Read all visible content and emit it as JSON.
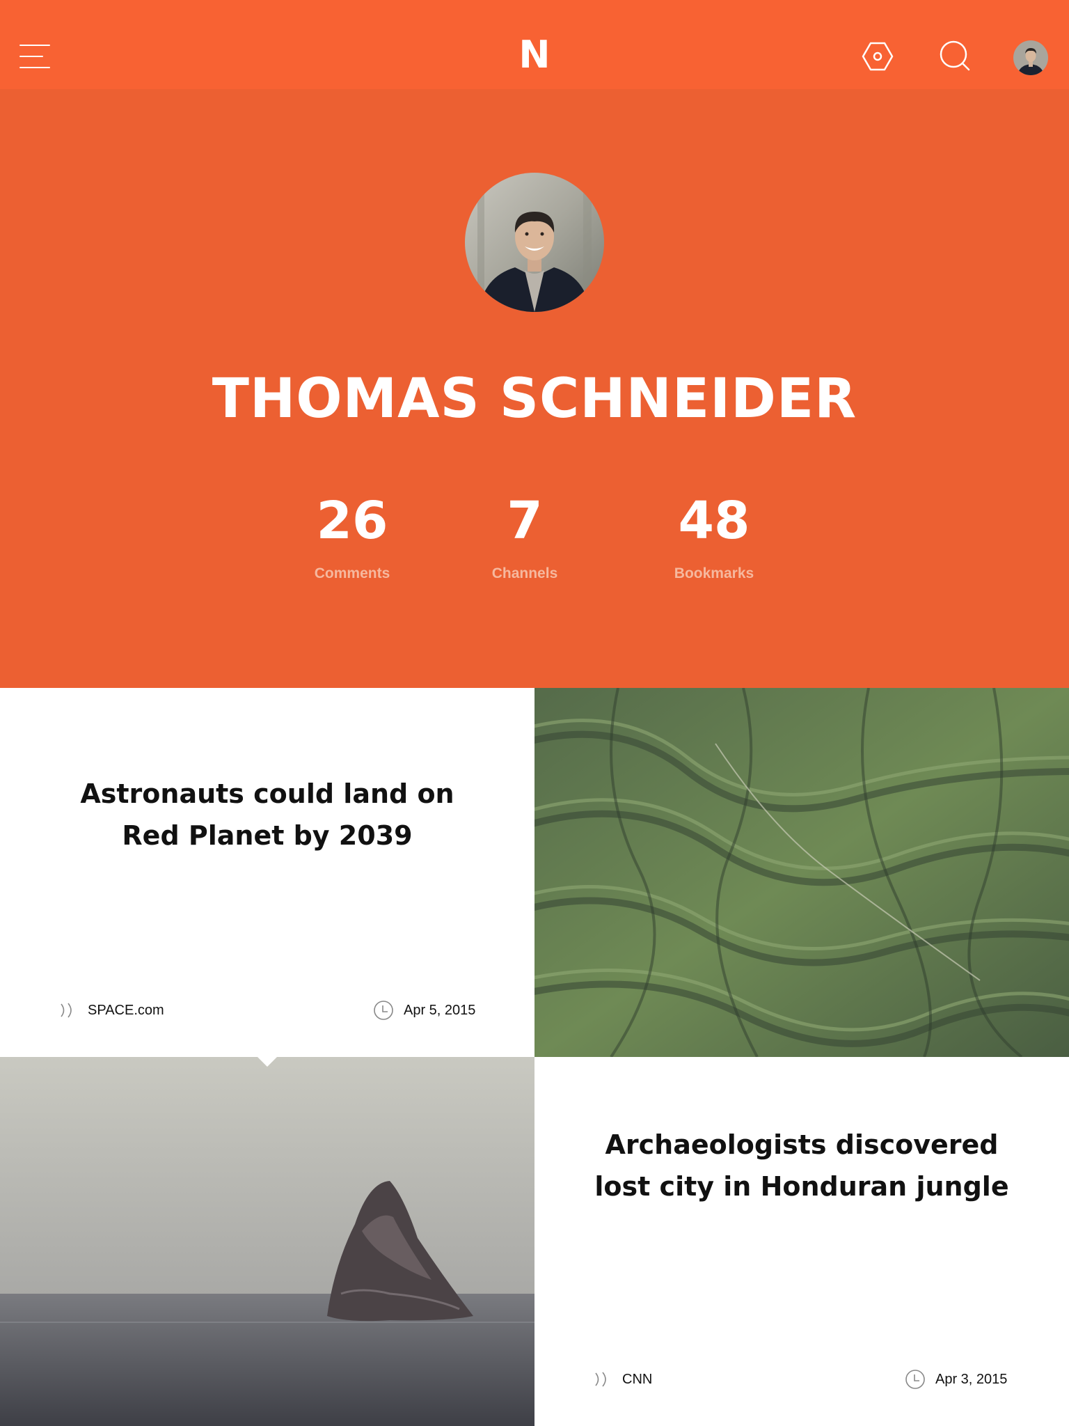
{
  "app": {
    "logo_letter": "N",
    "accent_color": "#F86233",
    "header_color": "#EC6032"
  },
  "topbar": {
    "icons": [
      "menu-icon",
      "settings-icon",
      "search-icon",
      "user-avatar"
    ]
  },
  "profile": {
    "name": "THOMAS SCHNEIDER",
    "stats": [
      {
        "value": "26",
        "label": "Comments"
      },
      {
        "value": "7",
        "label": "Channels"
      },
      {
        "value": "48",
        "label": "Bookmarks"
      }
    ]
  },
  "articles": [
    {
      "title": "Astronauts could land on Red Planet by 2039",
      "source": "SPACE.com",
      "date": "Apr 5, 2015",
      "image": "aerial green mountains"
    },
    {
      "title": "Archaeologists discovered lost city in Honduran jungle",
      "source": "CNN",
      "date": "Apr 3, 2015",
      "image": "rock in misty sea"
    }
  ]
}
